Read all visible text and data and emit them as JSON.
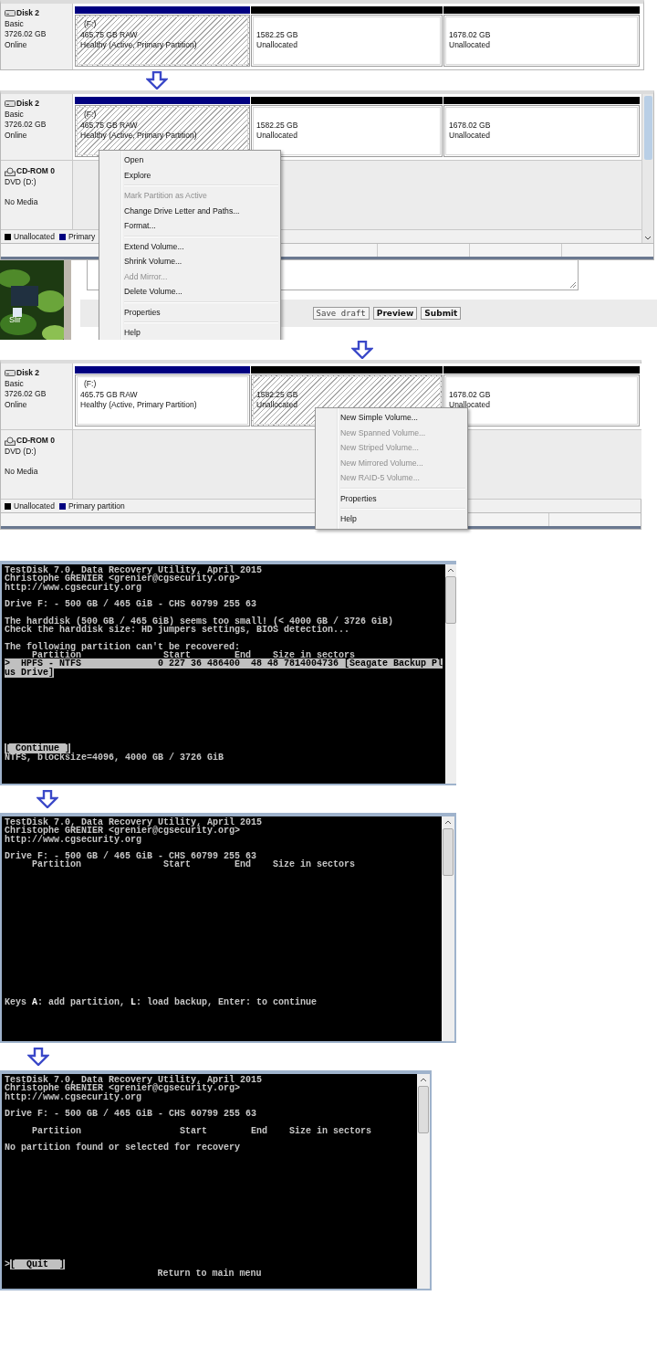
{
  "disk_views": [
    {
      "disk": {
        "name": "Disk 2",
        "type": "Basic",
        "size": "3726.02 GB",
        "status": "Online"
      },
      "partitions": [
        {
          "kind": "primary",
          "label": "(F:)",
          "size": "465.75 GB RAW",
          "status": "Healthy (Active, Primary Partition)",
          "selected": true
        },
        {
          "kind": "unallocated",
          "size": "1582.25 GB",
          "status": "Unallocated",
          "selected": false
        },
        {
          "kind": "unallocated",
          "size": "1678.02 GB",
          "status": "Unallocated",
          "selected": false
        }
      ]
    },
    {
      "disk": {
        "name": "Disk 2",
        "type": "Basic",
        "size": "3726.02 GB",
        "status": "Online"
      },
      "partitions": [
        {
          "kind": "primary",
          "label": "(F:)",
          "size": "465.75 GB RAW",
          "status": "Healthy (Active, Primary Partition)",
          "selected": true
        },
        {
          "kind": "unallocated",
          "size": "1582.25 GB",
          "status": "Unallocated",
          "selected": false
        },
        {
          "kind": "unallocated",
          "size": "1678.02 GB",
          "status": "Unallocated",
          "selected": false
        }
      ],
      "cdrom": {
        "name": "CD-ROM 0",
        "type": "DVD (D:)",
        "status": "No Media"
      },
      "legend": [
        {
          "label": "Unallocated",
          "color": "#000000"
        },
        {
          "label": "Primary",
          "color": "#000080"
        }
      ],
      "context_menu": [
        {
          "kind": "item",
          "label": "Open",
          "disabled": false
        },
        {
          "kind": "item",
          "label": "Explore",
          "disabled": false
        },
        {
          "kind": "separator"
        },
        {
          "kind": "item",
          "label": "Mark Partition as Active",
          "disabled": true
        },
        {
          "kind": "item",
          "label": "Change Drive Letter and Paths...",
          "disabled": false
        },
        {
          "kind": "item",
          "label": "Format...",
          "disabled": false
        },
        {
          "kind": "separator"
        },
        {
          "kind": "item",
          "label": "Extend Volume...",
          "disabled": false
        },
        {
          "kind": "item",
          "label": "Shrink Volume...",
          "disabled": false
        },
        {
          "kind": "item",
          "label": "Add Mirror...",
          "disabled": true
        },
        {
          "kind": "item",
          "label": "Delete Volume...",
          "disabled": false
        },
        {
          "kind": "separator"
        },
        {
          "kind": "item",
          "label": "Properties",
          "disabled": false
        },
        {
          "kind": "separator"
        },
        {
          "kind": "item",
          "label": "Help",
          "disabled": false
        }
      ],
      "post_form": {
        "desktop_icon_label": "Slir",
        "buttons": [
          {
            "label": "Save draft",
            "bold": false
          },
          {
            "label": "Preview",
            "bold": true
          },
          {
            "label": "Submit",
            "bold": true
          }
        ]
      }
    },
    {
      "disk": {
        "name": "Disk 2",
        "type": "Basic",
        "size": "3726.02 GB",
        "status": "Online"
      },
      "partitions": [
        {
          "kind": "primary",
          "label": "(F:)",
          "size": "465.75 GB RAW",
          "status": "Healthy (Active, Primary Partition)",
          "selected": false
        },
        {
          "kind": "unallocated",
          "size": "1582.25 GB",
          "status": "Unallocated",
          "selected": true
        },
        {
          "kind": "unallocated",
          "size": "1678.02 GB",
          "status": "Unallocated",
          "selected": false
        }
      ],
      "cdrom": {
        "name": "CD-ROM 0",
        "type": "DVD (D:)",
        "status": "No Media"
      },
      "legend": [
        {
          "label": "Unallocated",
          "color": "#000000"
        },
        {
          "label": "Primary partition",
          "color": "#000080"
        }
      ],
      "context_menu": [
        {
          "kind": "item",
          "label": "New Simple Volume...",
          "disabled": false
        },
        {
          "kind": "item",
          "label": "New Spanned Volume...",
          "disabled": true
        },
        {
          "kind": "item",
          "label": "New Striped Volume...",
          "disabled": true
        },
        {
          "kind": "item",
          "label": "New Mirrored Volume...",
          "disabled": true
        },
        {
          "kind": "item",
          "label": "New RAID-5 Volume...",
          "disabled": true
        },
        {
          "kind": "separator"
        },
        {
          "kind": "item",
          "label": "Properties",
          "disabled": false
        },
        {
          "kind": "separator"
        },
        {
          "kind": "item",
          "label": "Help",
          "disabled": false
        }
      ]
    }
  ],
  "terminals": [
    {
      "blocks": [
        [
          {
            "text": "TestDisk 7.0, Data Recovery Utility, April 2015",
            "selected": false
          },
          {
            "text": "Christophe GRENIER <grenier@cgsecurity.org>",
            "selected": false
          },
          {
            "text": "http://www.cgsecurity.org",
            "selected": false
          }
        ],
        [
          {
            "text": "Drive F: - 500 GB / 465 GiB - CHS 60799 255 63",
            "selected": false
          }
        ],
        [
          {
            "text": "The harddisk (500 GB / 465 GiB) seems too small! (< 4000 GB / 3726 GiB)",
            "selected": false
          },
          {
            "text": "Check the harddisk size: HD jumpers settings, BIOS detection...",
            "selected": false
          }
        ],
        [
          {
            "text": "The following partition can't be recovered:",
            "selected": false
          },
          {
            "text": "     Partition               Start        End    Size in sectors",
            "selected": false
          },
          {
            "text": ">  HPFS - NTFS              0 227 36 486400  48 48 7814004736 [Seagate Backup Pl",
            "selected": true
          },
          {
            "text": "us Drive]",
            "selected": true
          }
        ]
      ],
      "footer": [
        {
          "kind": "plain",
          "text": "[ Continue ]",
          "selected": true
        },
        {
          "kind": "plain",
          "text": "NTFS, blocksize=4096, 4000 GB / 3726 GiB",
          "selected": false
        }
      ]
    },
    {
      "blocks": [
        [
          {
            "text": "TestDisk 7.0, Data Recovery Utility, April 2015",
            "selected": false
          },
          {
            "text": "Christophe GRENIER <grenier@cgsecurity.org>",
            "selected": false
          },
          {
            "text": "http://www.cgsecurity.org",
            "selected": false
          }
        ],
        [
          {
            "text": "Drive F: - 500 GB / 465 GiB - CHS 60799 255 63",
            "selected": false
          },
          {
            "text": "     Partition               Start        End    Size in sectors",
            "selected": false
          }
        ]
      ],
      "footer": [
        {
          "kind": "plain",
          "text": "Keys **A**: add partition, **L**: load backup, Enter: to continue",
          "selected": false
        }
      ]
    },
    {
      "blocks": [
        [
          {
            "text": "TestDisk 7.0, Data Recovery Utility, April 2015",
            "selected": false
          },
          {
            "text": "Christophe GRENIER <grenier@cgsecurity.org>",
            "selected": false
          },
          {
            "text": "http://www.cgsecurity.org",
            "selected": false
          }
        ],
        [
          {
            "text": "Drive F: - 500 GB / 465 GiB - CHS 60799 255 63",
            "selected": false
          }
        ],
        [
          {
            "text": "     Partition                  Start        End    Size in sectors",
            "selected": false
          }
        ],
        [
          {
            "text": "No partition found or selected for recovery",
            "selected": false
          }
        ]
      ],
      "footer": [
        {
          "kind": "menu",
          "prefix": ">",
          "text": "[  Quit  ]",
          "selected": true
        },
        {
          "kind": "centered",
          "text": "Return to main menu",
          "selected": false
        }
      ]
    }
  ]
}
